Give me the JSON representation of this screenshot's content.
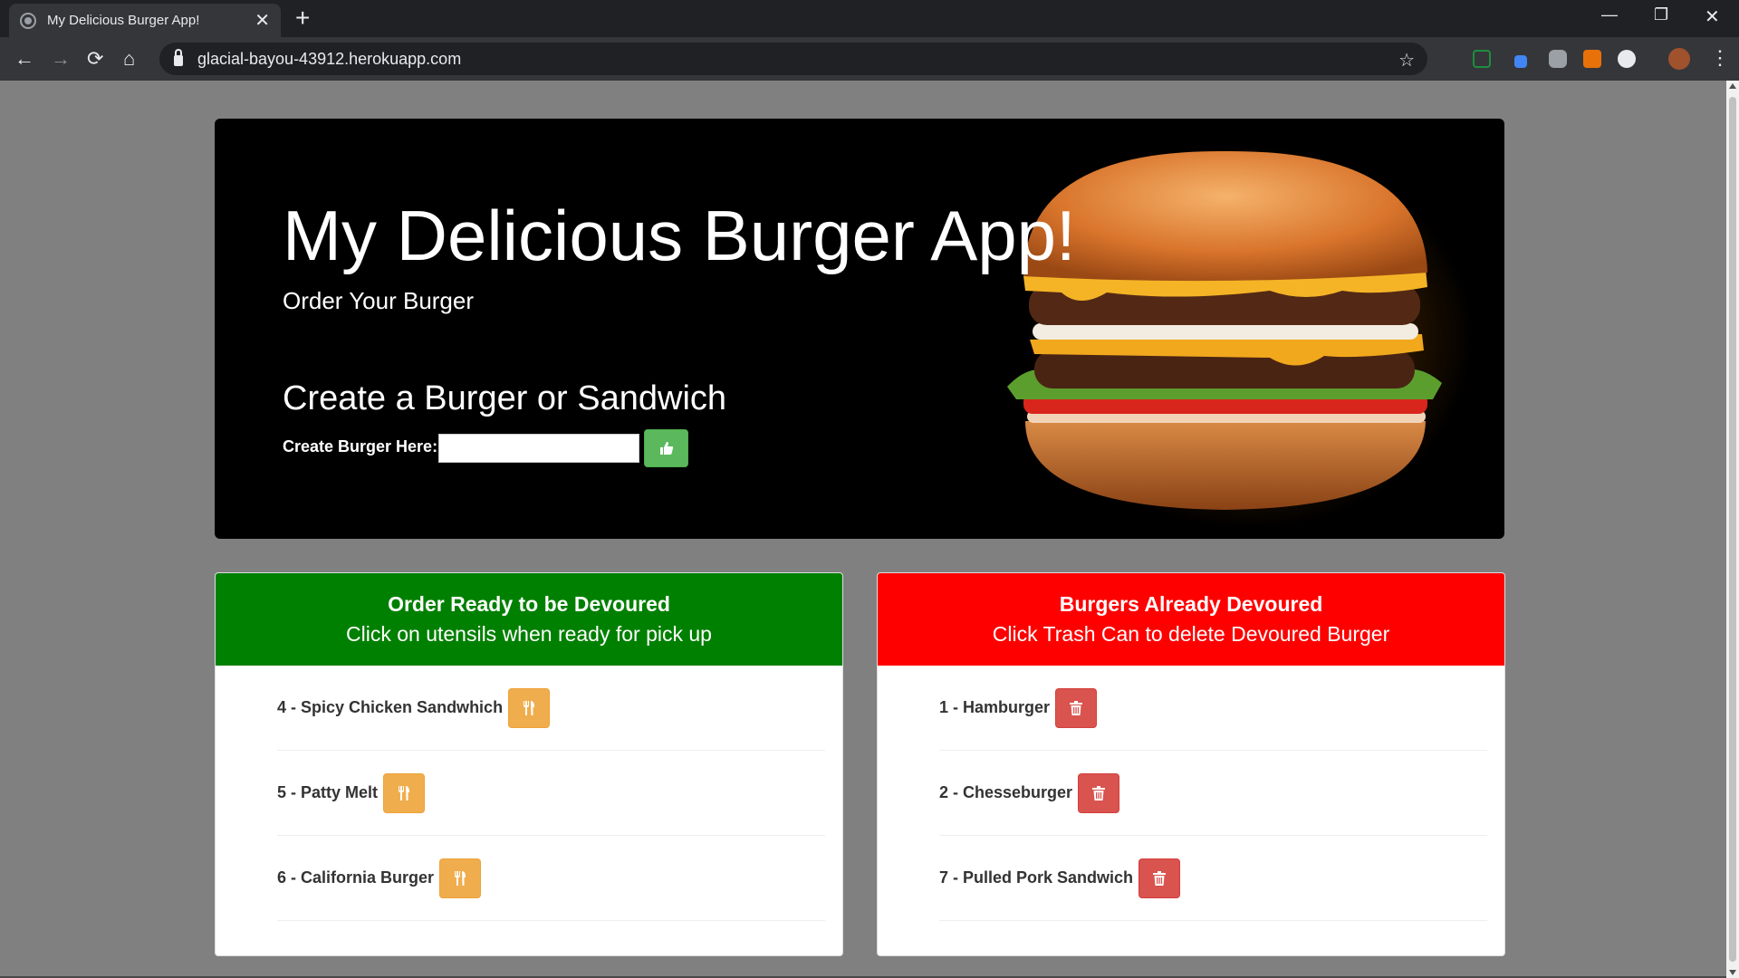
{
  "browser": {
    "tab_title": "My Delicious Burger App!",
    "tab_close": "✕",
    "new_tab": "+",
    "url": "glacial-bayou-43912.herokuapp.com",
    "window_minimize": "—",
    "window_restore": "❐",
    "window_close": "✕",
    "nav_back": "←",
    "nav_forward": "→",
    "nav_reload": "⟳",
    "nav_home": "⌂",
    "bookmark_star": "☆",
    "menu": "⋮"
  },
  "jumbotron": {
    "title": "My Delicious Burger App!",
    "subtitle": "Order Your Burger",
    "create_heading": "Create a Burger or Sandwich",
    "create_label": "Create Burger Here:",
    "create_input_value": "",
    "create_button_icon": "thumbs-up-icon"
  },
  "ready_panel": {
    "title": "Order Ready to be Devoured",
    "subtitle": "Click on utensils when ready for pick up",
    "color": "#008000",
    "button_icon": "utensils-icon",
    "items": [
      {
        "label": "4 - Spicy Chicken Sandwhich"
      },
      {
        "label": "5 - Patty Melt"
      },
      {
        "label": "6 - California Burger"
      }
    ]
  },
  "devoured_panel": {
    "title": "Burgers Already Devoured",
    "subtitle": "Click Trash Can to delete Devoured Burger",
    "color": "#ff0000",
    "button_icon": "trash-icon",
    "items": [
      {
        "label": "1 - Hamburger"
      },
      {
        "label": "2 - Chesseburger"
      },
      {
        "label": "7 - Pulled Pork Sandwich"
      }
    ]
  },
  "colors": {
    "page_background": "#808080",
    "create_button": "#5cb85c",
    "devour_button": "#f0ad4e",
    "delete_button": "#d9534f"
  }
}
